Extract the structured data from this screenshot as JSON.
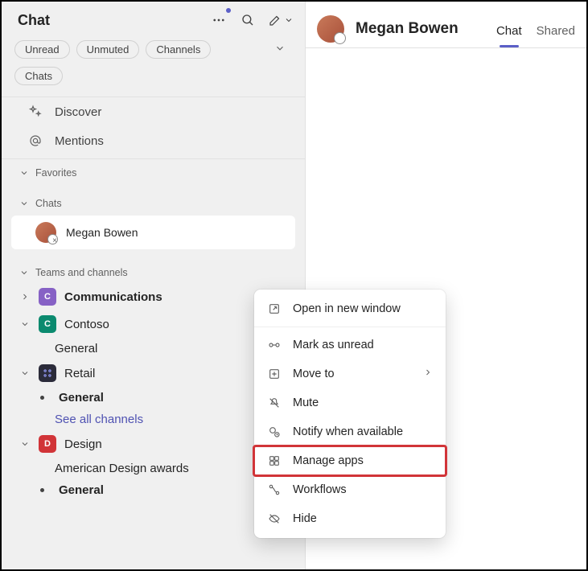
{
  "sidebar": {
    "title": "Chat",
    "filters": [
      "Unread",
      "Unmuted",
      "Channels",
      "Chats"
    ],
    "nav": {
      "discover": "Discover",
      "mentions": "Mentions"
    },
    "sections": {
      "favorites": "Favorites",
      "chats": "Chats",
      "teams": "Teams and channels"
    },
    "selected_chat": {
      "name": "Megan Bowen"
    },
    "teams": [
      {
        "name": "Communications",
        "badge": "C",
        "badgeClass": "badge-purple",
        "expanded": false,
        "bold": true
      },
      {
        "name": "Contoso",
        "badge": "C",
        "badgeClass": "badge-teal",
        "expanded": true,
        "children": [
          {
            "label": "General",
            "bold": false
          }
        ]
      },
      {
        "name": "Retail",
        "badge": "",
        "badgeClass": "badge-dark",
        "expanded": true,
        "children": [
          {
            "label": "General",
            "bold": true,
            "bullet": true
          },
          {
            "label": "See all channels",
            "link": true
          }
        ]
      },
      {
        "name": "Design",
        "badge": "D",
        "badgeClass": "badge-red",
        "expanded": true,
        "children": [
          {
            "label": "American Design awards"
          },
          {
            "label": "General",
            "bold": true,
            "bullet": true
          }
        ]
      }
    ]
  },
  "main": {
    "name": "Megan Bowen",
    "tabs": [
      {
        "label": "Chat",
        "active": true
      },
      {
        "label": "Shared",
        "active": false
      }
    ]
  },
  "context_menu": {
    "items": [
      {
        "icon": "open-new",
        "label": "Open in new window"
      },
      {
        "icon": "unread",
        "label": "Mark as unread"
      },
      {
        "icon": "move",
        "label": "Move to",
        "submenu": true
      },
      {
        "icon": "mute",
        "label": "Mute"
      },
      {
        "icon": "notify",
        "label": "Notify when available"
      },
      {
        "icon": "apps",
        "label": "Manage apps",
        "highlight": true
      },
      {
        "icon": "workflows",
        "label": "Workflows"
      },
      {
        "icon": "hide",
        "label": "Hide"
      }
    ]
  }
}
